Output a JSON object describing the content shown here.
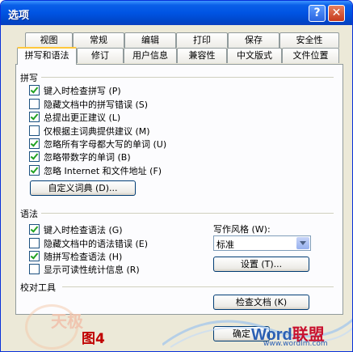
{
  "window": {
    "title": "选项",
    "help": "?",
    "close": "✕"
  },
  "tabs": {
    "row1": [
      "视图",
      "常规",
      "编辑",
      "打印",
      "保存",
      "安全性"
    ],
    "row2": [
      "拼写和语法",
      "修订",
      "用户信息",
      "兼容性",
      "中文版式",
      "文件位置"
    ],
    "active": "拼写和语法"
  },
  "spelling": {
    "title": "拼写",
    "options": [
      {
        "label": "键入时检查拼写 (P)",
        "checked": true
      },
      {
        "label": "隐藏文档中的拼写错误 (S)",
        "checked": false
      },
      {
        "label": "总提出更正建议 (L)",
        "checked": true
      },
      {
        "label": "仅根据主词典提供建议 (M)",
        "checked": false
      },
      {
        "label": "忽略所有字母都大写的单词 (U)",
        "checked": true
      },
      {
        "label": "忽略带数字的单词 (B)",
        "checked": true
      },
      {
        "label": "忽略 Internet 和文件地址 (F)",
        "checked": true
      }
    ],
    "custom_dict_button": "自定义词典 (D)..."
  },
  "grammar": {
    "title": "语法",
    "options": [
      {
        "label": "键入时检查语法 (G)",
        "checked": true
      },
      {
        "label": "隐藏文档中的语法错误 (E)",
        "checked": false
      },
      {
        "label": "随拼写检查语法 (H)",
        "checked": true
      },
      {
        "label": "显示可读性统计信息 (R)",
        "checked": false
      }
    ],
    "style_label": "写作风格 (W):",
    "style_value": "标准",
    "settings_button": "设置 (T)..."
  },
  "proofing": {
    "title": "校对工具",
    "check_doc_button": "检查文档 (K)"
  },
  "footer": {
    "ok_button": "确定"
  },
  "watermark": {
    "figure": "图4",
    "word": "Word",
    "site": "联盟",
    "url": "www.wordlm.com",
    "left_text": "天极"
  }
}
